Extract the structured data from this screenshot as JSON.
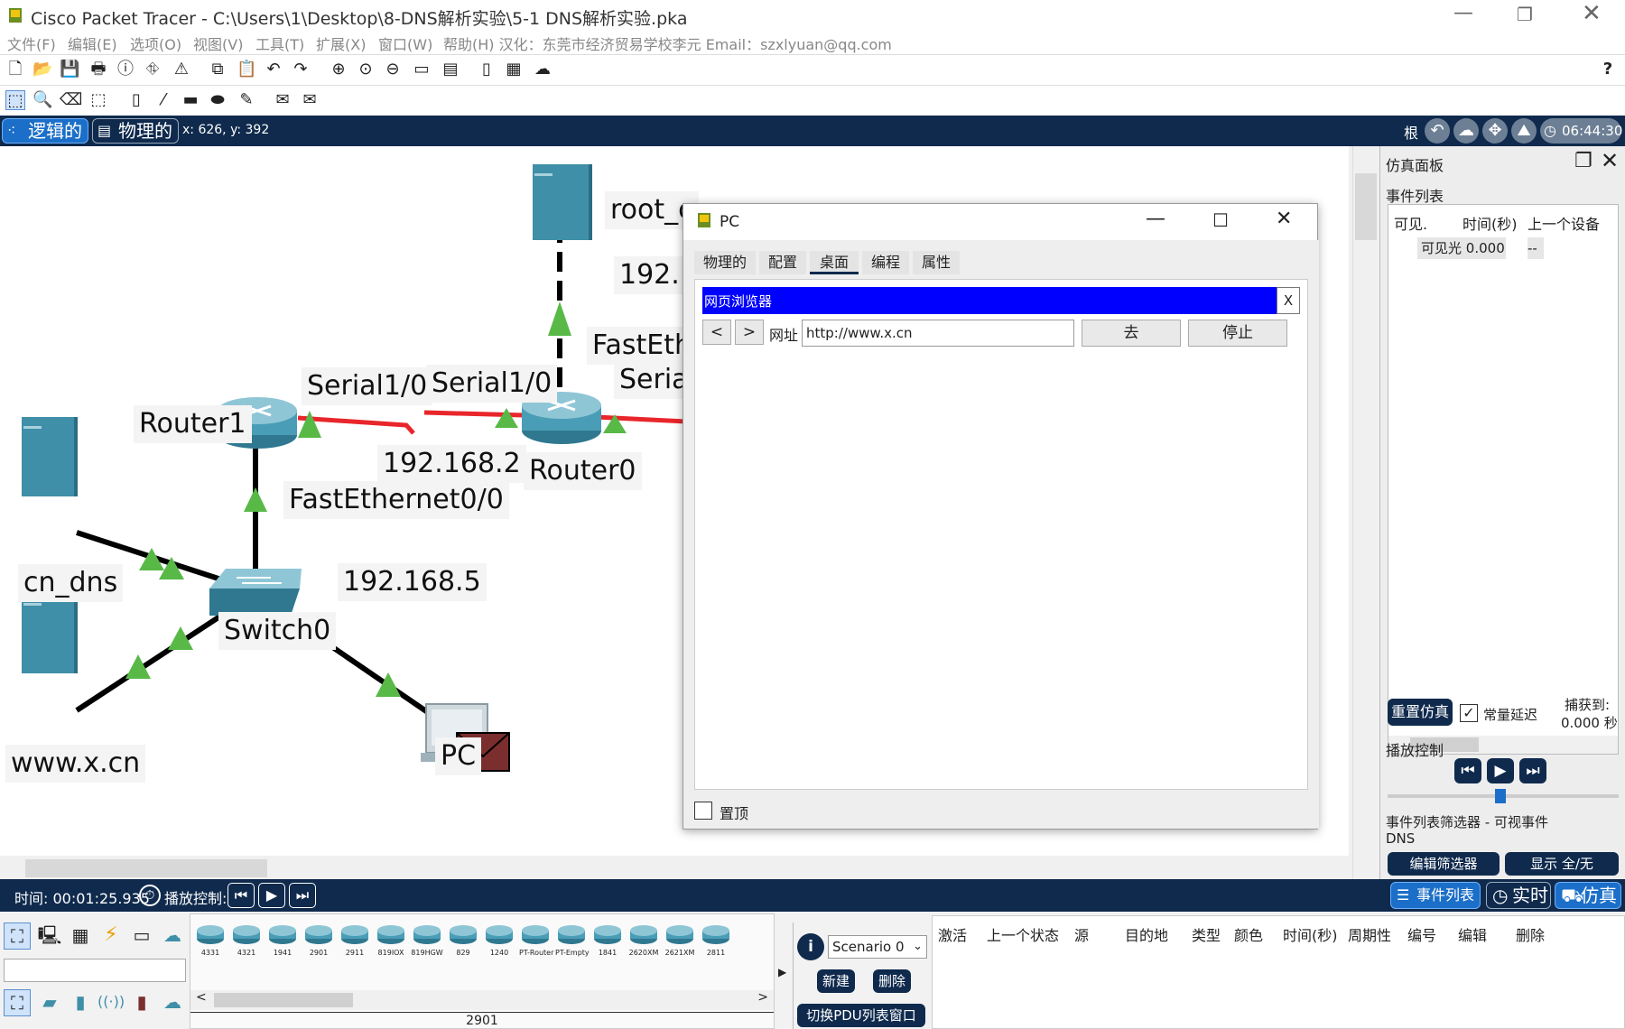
{
  "window": {
    "title": "Cisco Packet Tracer - C:\\Users\\1\\Desktop\\8-DNS解析实验\\5-1  DNS解析实验.pka"
  },
  "menu": [
    "文件(F)",
    "编辑(E)",
    "选项(O)",
    "视图(V)",
    "工具(T)",
    "扩展(X)",
    "窗口(W)",
    "帮助(H) 汉化：东莞市经济贸易学校李元  Email：szxlyuan@qq.com"
  ],
  "logical": {
    "logical_label": "逻辑的",
    "physical_label": "物理的",
    "coords": "x: 626, y: 392",
    "root": "根",
    "clock": "06:44:30"
  },
  "topology": {
    "labels": {
      "root": "root_c",
      "root_ip": "192.1",
      "fa_top": "FastEth",
      "serial_r": "Seria",
      "serial_a": "Serial1/0",
      "serial_b": "Serial1/0",
      "router1": "Router1",
      "router0": "Router0",
      "net2": "192.168.2",
      "fa00": "FastEthernet0/0",
      "cn_dns": "cn_dns",
      "net5": "192.168.5",
      "switch0": "Switch0",
      "www": "www.x.cn",
      "pc": "PC"
    }
  },
  "dialog": {
    "title": "PC",
    "tabs": [
      "物理的",
      "配置",
      "桌面",
      "编程",
      "属性"
    ],
    "browser": {
      "title": "网页浏览器",
      "close": "X",
      "back": "<",
      "forward": ">",
      "url_label": "网址",
      "url": "http://www.x.cn",
      "go": "去",
      "stop": "停止"
    },
    "pin_label": "置顶"
  },
  "sim": {
    "title": "仿真面板",
    "event_list": "事件列表",
    "cols": [
      "可见.",
      "时间(秒)",
      "上一个设备"
    ],
    "row": {
      "vis": "可见光",
      "time": "0.000",
      "prev": "--"
    },
    "reset": "重置仿真",
    "const_delay": "常量延迟",
    "captured": "捕获到:",
    "captured_val": "0.000 秒",
    "play_ctrl": "播放控制",
    "filter_title": "事件列表筛选器 - 可视事件",
    "filter_val": "DNS",
    "edit_filter": "编辑筛选器",
    "show_all": "显示 全/无"
  },
  "timebar": {
    "time": "时间: 00:01:25.935",
    "play": "播放控制:",
    "events": "事件列表",
    "realtime": "实时",
    "sim": "仿真"
  },
  "bottom": {
    "devices": [
      "4331",
      "4321",
      "1941",
      "2901",
      "2911",
      "819IOX",
      "819HGW",
      "829",
      "1240",
      "PT-Router",
      "PT-Empty",
      "1841",
      "2620XM",
      "2621XM",
      "2811"
    ],
    "selected": "2901",
    "scenario": "Scenario 0",
    "new": "新建",
    "delete": "删除",
    "switch_pdu": "切换PDU列表窗口",
    "pdu_cols": [
      "激活",
      "上一个状态",
      "源",
      "目的地",
      "类型",
      "颜色",
      "时间(秒)",
      "周期性",
      "编号",
      "编辑",
      "删除"
    ]
  },
  "colors": {
    "navy": "#0f2a4d",
    "link_red": "#e8262b",
    "arrow_green": "#58b947",
    "browser_blue": "#0000ff",
    "device_teal": "#3f8fa8"
  }
}
